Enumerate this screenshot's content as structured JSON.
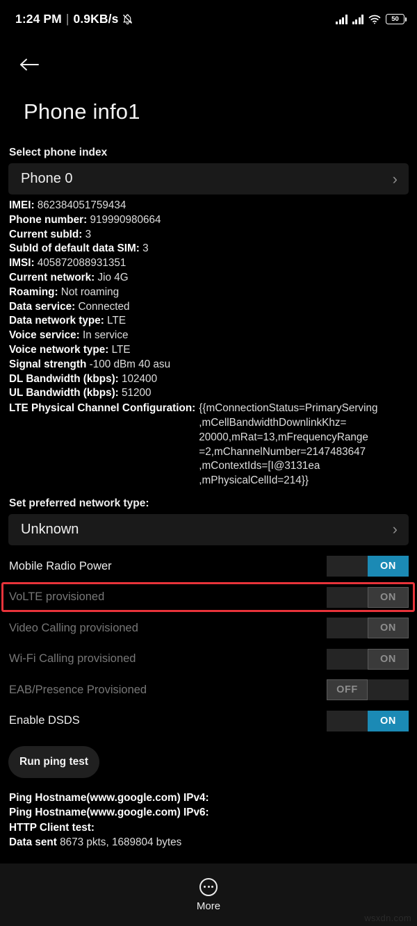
{
  "status_bar": {
    "time": "1:24 PM",
    "separator": "|",
    "data_rate": "0.9KB/s",
    "silent_icon": "bell-slash-icon",
    "signal_icon_1": "signal-bars-icon",
    "signal_icon_2": "signal-bars-icon",
    "wifi_icon": "wifi-icon",
    "battery_level": "50"
  },
  "app_bar": {
    "back_icon": "arrow-left-icon",
    "title": "Phone info1"
  },
  "phone_index": {
    "label": "Select phone index",
    "selected": "Phone 0",
    "chevron": "chevron-right-icon"
  },
  "info": [
    {
      "key": "IMEI:",
      "value": "862384051759434"
    },
    {
      "key": "Phone number:",
      "value": "919990980664"
    },
    {
      "key": "Current subId:",
      "value": "3"
    },
    {
      "key": "SubId of default data SIM:",
      "value": "3"
    },
    {
      "key": "IMSI:",
      "value": "405872088931351"
    },
    {
      "key": "Current network:",
      "value": "Jio 4G"
    },
    {
      "key": "Roaming:",
      "value": "Not roaming"
    },
    {
      "key": "Data service:",
      "value": "Connected"
    },
    {
      "key": "Data network type:",
      "value": "LTE"
    },
    {
      "key": "Voice service:",
      "value": "In service"
    },
    {
      "key": "Voice network type:",
      "value": "LTE"
    },
    {
      "key": "Signal strength",
      "value": "-100 dBm   40 asu"
    },
    {
      "key": "DL Bandwidth (kbps):",
      "value": "102400"
    },
    {
      "key": "UL Bandwidth (kbps):",
      "value": "51200"
    }
  ],
  "lte_config": {
    "key": "LTE Physical Channel Configuration:",
    "lines": [
      "{{mConnectionStatus=PrimaryServing",
      ",mCellBandwidthDownlinkKhz=",
      "20000,mRat=13,mFrequencyRange",
      "=2,mChannelNumber=2147483647",
      ",mContextIds=[I@3131ea",
      ",mPhysicalCellId=214}}"
    ]
  },
  "preferred_network": {
    "label": "Set preferred network type:",
    "selected": "Unknown",
    "chevron": "chevron-right-icon"
  },
  "toggles": [
    {
      "label": "Mobile Radio Power",
      "state": "ON",
      "enabled": true,
      "highlighted": false
    },
    {
      "label": "VoLTE provisioned",
      "state": "ON",
      "enabled": false,
      "highlighted": true
    },
    {
      "label": "Video Calling provisioned",
      "state": "ON",
      "enabled": false,
      "highlighted": false
    },
    {
      "label": "Wi-Fi Calling provisioned",
      "state": "ON",
      "enabled": false,
      "highlighted": false
    },
    {
      "label": "EAB/Presence Provisioned",
      "state": "OFF",
      "enabled": false,
      "highlighted": false
    },
    {
      "label": "Enable DSDS",
      "state": "ON",
      "enabled": true,
      "highlighted": false
    }
  ],
  "ping": {
    "button_label": "Run ping test",
    "results": [
      {
        "key": "Ping Hostname(www.google.com) IPv4:",
        "value": ""
      },
      {
        "key": "Ping Hostname(www.google.com) IPv6:",
        "value": ""
      },
      {
        "key": "HTTP Client test:",
        "value": ""
      },
      {
        "key": "Data sent",
        "value": "8673 pkts, 1689804 bytes"
      }
    ]
  },
  "bottom_bar": {
    "more_icon": "more-dots-circle-icon",
    "more_label": "More"
  },
  "watermark": "wsxdn.com",
  "colors": {
    "accent_blue": "#1b8ab5",
    "highlight_red": "#e8333a",
    "background": "#000000",
    "field_bg": "#1a1a1a"
  }
}
